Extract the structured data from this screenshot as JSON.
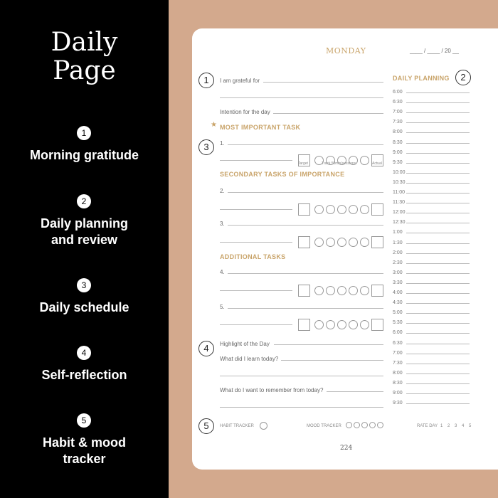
{
  "sidebar": {
    "title_line1": "Daily",
    "title_line2": "Page",
    "items": [
      {
        "num": "1",
        "label": "Morning gratitude"
      },
      {
        "num": "2",
        "label": "Daily planning",
        "label2": "and review"
      },
      {
        "num": "3",
        "label": "Daily schedule"
      },
      {
        "num": "4",
        "label": "Self-reflection"
      },
      {
        "num": "5",
        "label": "Habit & mood",
        "label2": "tracker"
      }
    ]
  },
  "page": {
    "day": "MONDAY",
    "date": "____ / ____ / 20 __",
    "grateful": "I am grateful for",
    "intention": "Intention for the day",
    "mit_heading": "MOST IMPORTANT TASK",
    "secondary_heading": "SECONDARY TASKS OF IMPORTANCE",
    "additional_heading": "ADDITIONAL TASKS",
    "task_numbers": [
      "1.",
      "2.",
      "3.",
      "4.",
      "5."
    ],
    "target_label": "Target",
    "track_label": "Track 50min/sessions",
    "actual_label": "Actual",
    "highlight": "Highlight of the Day",
    "learn": "What did I learn today?",
    "remember": "What do I want to remember from today?",
    "planning_heading": "DAILY PLANNING",
    "times": [
      "6:00",
      "6:30",
      "7:00",
      "7:30",
      "8:00",
      "8:30",
      "9:00",
      "9:30",
      "10:00",
      "10:30",
      "11:00",
      "11:30",
      "12:00",
      "12:30",
      "1:00",
      "1:30",
      "2:00",
      "2:30",
      "3:00",
      "3:30",
      "4:00",
      "4:30",
      "5:00",
      "5:30",
      "6:00",
      "6:30",
      "7:00",
      "7:30",
      "8:00",
      "8:30",
      "9:00",
      "9:30"
    ],
    "habit_label": "HABIT TRACKER",
    "mood_label": "MOOD TRACKER",
    "mood_icons": [
      "neutral-face",
      "sad-face",
      "meh-face",
      "smile-face",
      "happy-face"
    ],
    "rate_label": "RATE DAY",
    "rate_values": [
      "1",
      "2",
      "3",
      "4",
      "5"
    ],
    "page_number": "224",
    "markers": [
      "1",
      "2",
      "3",
      "4",
      "5"
    ]
  },
  "colors": {
    "accent": "#c9a46a",
    "background": "#d3a98d",
    "sidebar": "#000000"
  }
}
